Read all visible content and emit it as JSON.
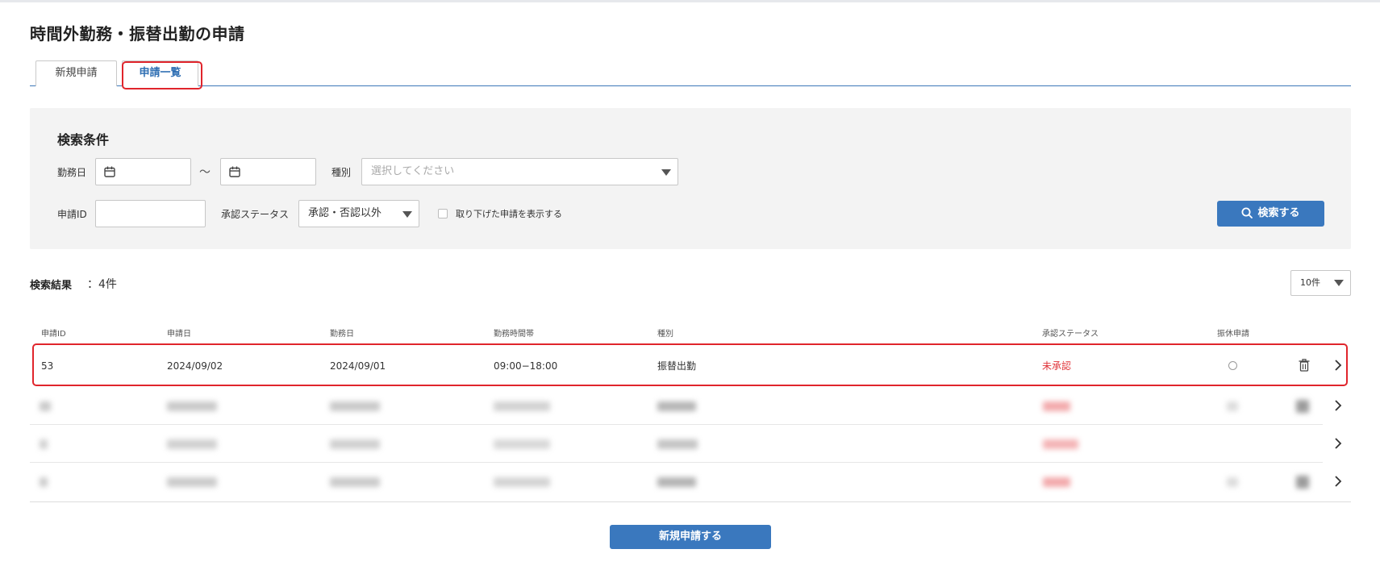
{
  "page": {
    "title": "時間外勤務・振替出勤の申請"
  },
  "tabs": [
    {
      "label": "新規申請",
      "active": false
    },
    {
      "label": "申請一覧",
      "active": true
    }
  ],
  "search": {
    "heading": "検索条件",
    "work_date_label": "勤務日",
    "range_separator": "～",
    "type_label": "種別",
    "type_placeholder": "選択してください",
    "request_id_label": "申請ID",
    "approval_status_label": "承認ステータス",
    "approval_status_value": "承認・否認以外",
    "show_withdrawn_label": "取り下げた申請を表示する",
    "show_withdrawn_checked": false,
    "search_button_label": "検索する"
  },
  "results": {
    "label": "検索結果",
    "count_text": "：4件",
    "per_page": "10件"
  },
  "table": {
    "columns": [
      "申請ID",
      "申請日",
      "勤務日",
      "勤務時間帯",
      "種別",
      "承認ステータス",
      "振休申請"
    ],
    "rows": [
      {
        "id": "53",
        "applied": "2024/09/02",
        "work_date": "2024/09/01",
        "hours": "09:00−18:00",
        "type": "振替出勤",
        "status": "未承認",
        "substitute_leave": "○"
      }
    ]
  },
  "footer": {
    "new_request_button_label": "新規申請する"
  },
  "colors": {
    "accent": "#3a78be",
    "status_pending": "#e0343a",
    "highlight": "#e0252c"
  }
}
